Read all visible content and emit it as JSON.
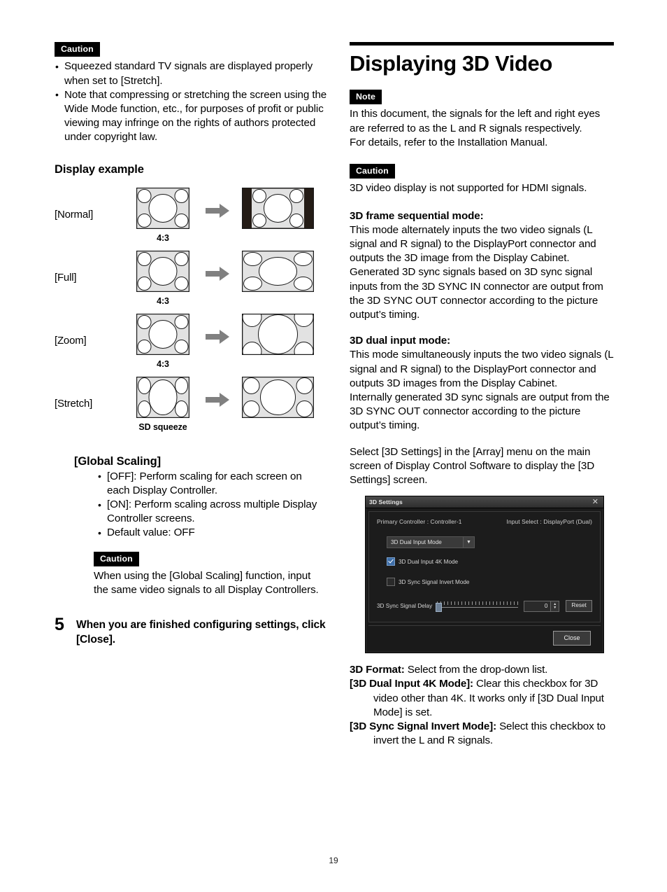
{
  "page_number": "19",
  "left_column": {
    "caution_top": {
      "badge": "Caution",
      "bullets": [
        "Squeezed standard TV signals are displayed properly when set to [Stretch].",
        "Note that compressing or stretching the screen using the Wide Mode function, etc., for purposes of profit or public viewing may infringe on the rights of authors protected under copyright law."
      ]
    },
    "display_example": {
      "heading": "Display example",
      "rows": [
        {
          "label": "[Normal]",
          "source_caption": "4:3",
          "mode": "normal"
        },
        {
          "label": "[Full]",
          "source_caption": "4:3",
          "mode": "full"
        },
        {
          "label": "[Zoom]",
          "source_caption": "4:3",
          "mode": "zoom"
        },
        {
          "label": "[Stretch]",
          "source_caption": "SD squeeze",
          "mode": "stretch"
        }
      ],
      "arrow_icon": "right-arrow-icon"
    },
    "global_scaling": {
      "heading": "[Global Scaling]",
      "bullets": [
        "[OFF]: Perform scaling for each screen on each Display Controller.",
        "[ON]: Perform scaling across multiple Display Controller screens.",
        "Default value: OFF"
      ],
      "caution": {
        "badge": "Caution",
        "text": "When using the [Global Scaling] function, input the same video signals to all Display Controllers."
      }
    },
    "step5": {
      "number": "5",
      "text": "When you are finished configuring settings, click [Close]."
    }
  },
  "right_column": {
    "title": "Displaying 3D Video",
    "note": {
      "badge": "Note",
      "line1": "In this document, the signals for the left and right eyes are referred to as the L and R signals respectively.",
      "line2": "For details, refer to the Installation Manual."
    },
    "caution": {
      "badge": "Caution",
      "text": "3D video display is not supported for HDMI signals."
    },
    "frame_sequential": {
      "heading": "3D frame sequential mode:",
      "p1": "This mode alternately inputs the two video signals (L signal and R signal) to the DisplayPort connector and outputs the 3D image from the Display Cabinet.",
      "p2": "Generated 3D sync signals based on 3D sync signal inputs from the 3D SYNC IN connector are output from the 3D SYNC OUT connector according to the picture output’s timing."
    },
    "dual_input": {
      "heading": "3D dual input mode:",
      "p1": "This mode simultaneously inputs the two video signals (L signal and R signal) to the DisplayPort connector and outputs 3D images from the Display Cabinet.",
      "p2": "Internally generated 3D sync signals are output from the 3D SYNC OUT connector according to the picture output’s timing."
    },
    "select_paragraph": "Select [3D Settings] in the [Array] menu on the main screen of Display Control Software to display the [3D Settings] screen.",
    "dialog": {
      "title": "3D Settings",
      "close_icon": "close-icon",
      "primary_controller": "Primary Controller : Controller-1",
      "input_select": "Input Select : DisplayPort (Dual)",
      "format_select": {
        "value": "3D Dual Input Mode",
        "arrow_icon": "chevron-down-icon"
      },
      "checkbox_4k": {
        "label": "3D Dual Input 4K Mode",
        "checked": true
      },
      "checkbox_invert": {
        "label": "3D Sync Signal Invert Mode",
        "checked": false
      },
      "delay": {
        "label": "3D Sync Signal Delay",
        "value": "0",
        "reset_label": "Reset"
      },
      "close_button": "Close"
    },
    "definitions": [
      {
        "term": "3D Format:",
        "desc": " Select from the drop-down list."
      },
      {
        "term": "[3D Dual Input 4K Mode]:",
        "desc": " Clear this checkbox for 3D video other than 4K. It works only if [3D Dual Input Mode] is set."
      },
      {
        "term": "[3D Sync Signal Invert Mode]:",
        "desc": " Select this checkbox to invert the L and R signals."
      }
    ]
  }
}
